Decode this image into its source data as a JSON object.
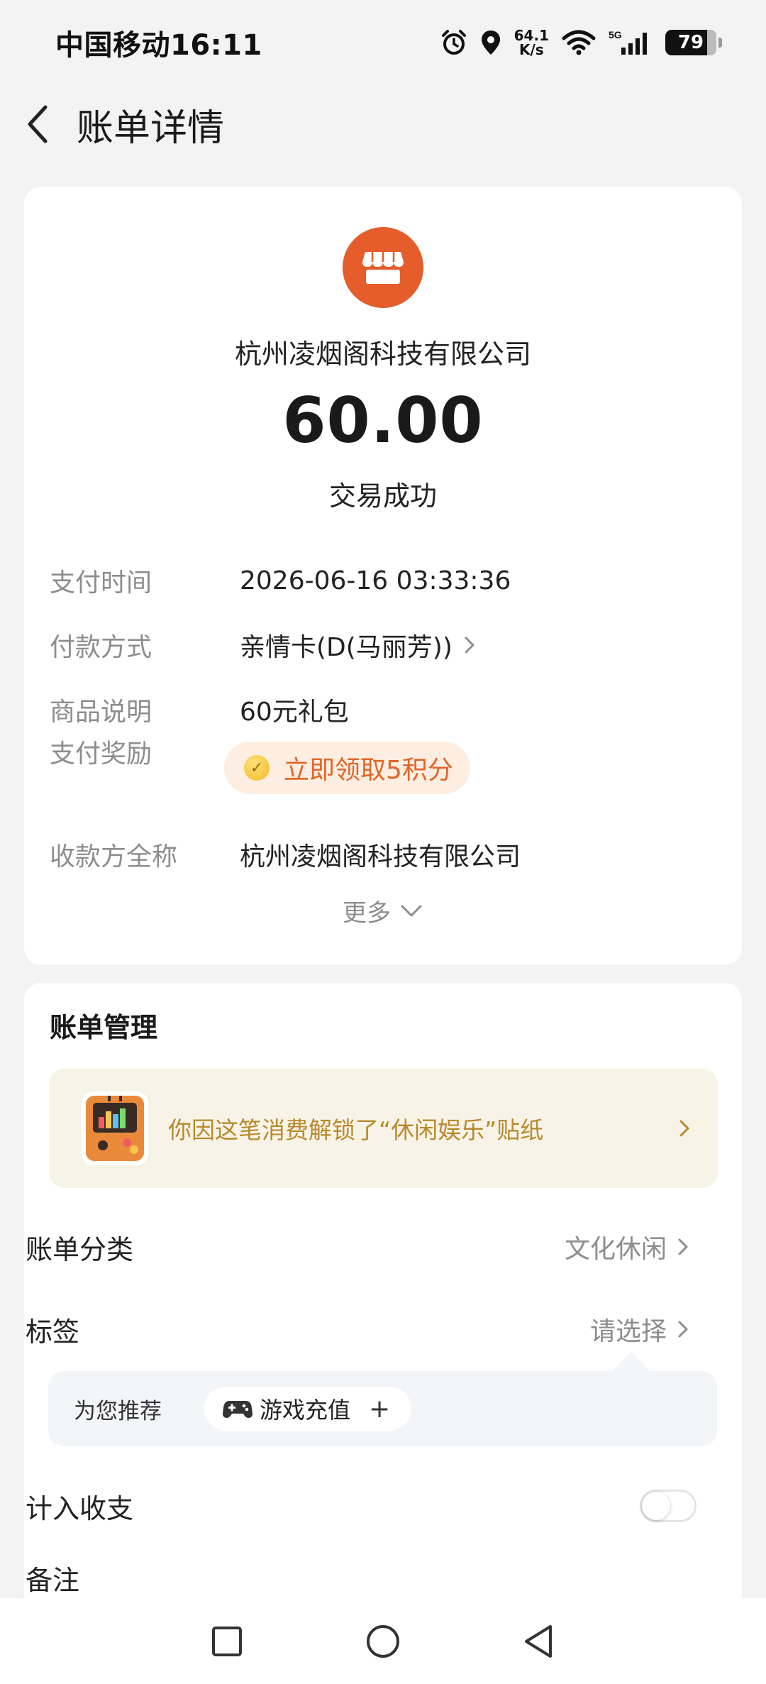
{
  "status_bar": {
    "carrier_time": "中国移动16:11",
    "net_speed_value": "64.1",
    "net_speed_unit": "K/s",
    "network_type": "5G",
    "battery": "79"
  },
  "header": {
    "title": "账单详情"
  },
  "summary": {
    "merchant_name": "杭州凌烟阁科技有限公司",
    "amount": "60.00",
    "status": "交易成功",
    "details": {
      "pay_time_label": "支付时间",
      "pay_time_value": "2026-06-16 03:33:36",
      "pay_method_label": "付款方式",
      "pay_method_value": "亲情卡(D(马丽芳))",
      "goods_label": "商品说明",
      "goods_value": "60元礼包",
      "reward_label": "支付奖励",
      "reward_value": "立即领取5积分",
      "payee_label": "收款方全称",
      "payee_value": "杭州凌烟阁科技有限公司"
    },
    "more_label": "更多"
  },
  "manage": {
    "title": "账单管理",
    "sticker_banner": "你因这笔消费解锁了“休闲娱乐”贴纸",
    "category_label": "账单分类",
    "category_value": "文化休闲",
    "tags_label": "标签",
    "tags_value": "请选择",
    "recommend_label": "为您推荐",
    "recommend_chip": "游戏充值",
    "income_label": "计入收支",
    "income_enabled": false,
    "note_label": "备注"
  },
  "colors": {
    "brand_orange": "#e45d2b",
    "reward_text": "#e0662a",
    "sticker_text": "#b8892c"
  }
}
